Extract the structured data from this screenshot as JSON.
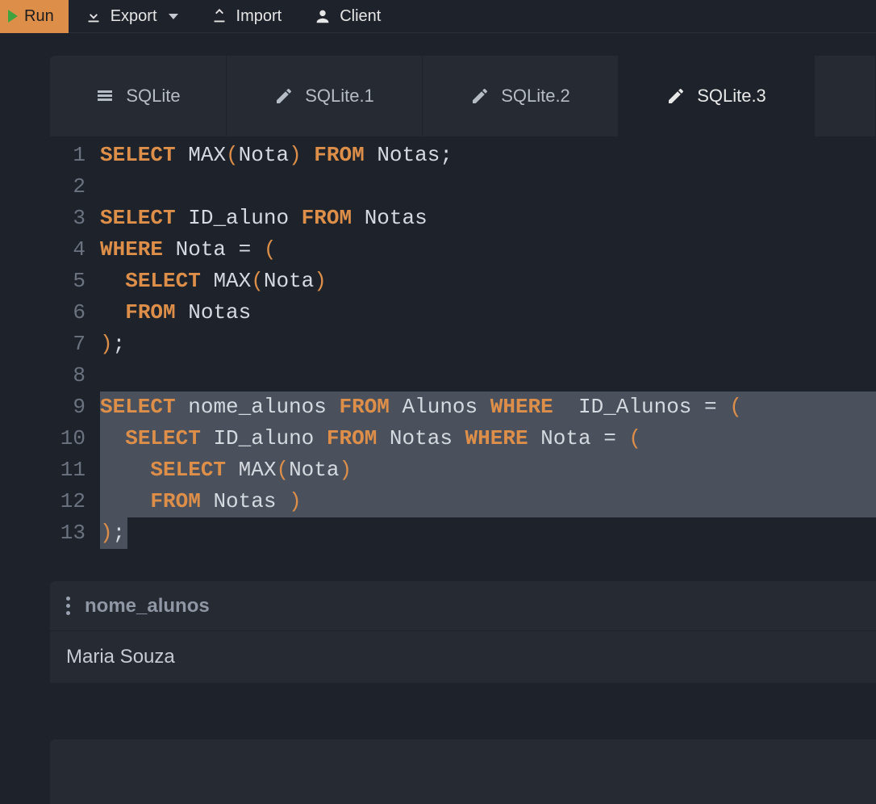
{
  "toolbar": {
    "run": "Run",
    "export": "Export",
    "import": "Import",
    "client": "Client"
  },
  "tabs": [
    {
      "label": "SQLite",
      "icon": "database-icon",
      "active": false
    },
    {
      "label": "SQLite.1",
      "icon": "edit-icon",
      "active": false
    },
    {
      "label": "SQLite.2",
      "icon": "edit-icon",
      "active": false
    },
    {
      "label": "SQLite.3",
      "icon": "edit-icon",
      "active": true
    }
  ],
  "code_lines": [
    {
      "n": 1,
      "tokens": [
        [
          "kw",
          "SELECT"
        ],
        [
          "sp",
          " "
        ],
        [
          "fn",
          "MAX"
        ],
        [
          "pn",
          "("
        ],
        [
          "id",
          "Nota"
        ],
        [
          "pn",
          ")"
        ],
        [
          "sp",
          " "
        ],
        [
          "kw",
          "FROM"
        ],
        [
          "sp",
          " "
        ],
        [
          "id",
          "Notas"
        ],
        [
          "op",
          ";"
        ]
      ]
    },
    {
      "n": 2,
      "tokens": []
    },
    {
      "n": 3,
      "tokens": [
        [
          "kw",
          "SELECT"
        ],
        [
          "sp",
          " "
        ],
        [
          "id",
          "ID_aluno"
        ],
        [
          "sp",
          " "
        ],
        [
          "kw",
          "FROM"
        ],
        [
          "sp",
          " "
        ],
        [
          "id",
          "Notas"
        ]
      ]
    },
    {
      "n": 4,
      "tokens": [
        [
          "kw",
          "WHERE"
        ],
        [
          "sp",
          " "
        ],
        [
          "id",
          "Nota"
        ],
        [
          "sp",
          " "
        ],
        [
          "op",
          "="
        ],
        [
          "sp",
          " "
        ],
        [
          "pn",
          "("
        ]
      ]
    },
    {
      "n": 5,
      "tokens": [
        [
          "sp",
          "  "
        ],
        [
          "kw",
          "SELECT"
        ],
        [
          "sp",
          " "
        ],
        [
          "fn",
          "MAX"
        ],
        [
          "pn",
          "("
        ],
        [
          "id",
          "Nota"
        ],
        [
          "pn",
          ")"
        ]
      ]
    },
    {
      "n": 6,
      "tokens": [
        [
          "sp",
          "  "
        ],
        [
          "kw",
          "FROM"
        ],
        [
          "sp",
          " "
        ],
        [
          "id",
          "Notas"
        ]
      ]
    },
    {
      "n": 7,
      "tokens": [
        [
          "pn",
          ")"
        ],
        [
          "op",
          ";"
        ]
      ]
    },
    {
      "n": 8,
      "tokens": []
    },
    {
      "n": 9,
      "sel": "full",
      "tokens": [
        [
          "kw",
          "SELECT"
        ],
        [
          "sp",
          " "
        ],
        [
          "id",
          "nome_alunos"
        ],
        [
          "sp",
          " "
        ],
        [
          "kw",
          "FROM"
        ],
        [
          "sp",
          " "
        ],
        [
          "id",
          "Alunos"
        ],
        [
          "sp",
          " "
        ],
        [
          "kw",
          "WHERE"
        ],
        [
          "sp",
          "  "
        ],
        [
          "id",
          "ID_Alunos"
        ],
        [
          "sp",
          " "
        ],
        [
          "op",
          "="
        ],
        [
          "sp",
          " "
        ],
        [
          "pn",
          "("
        ]
      ]
    },
    {
      "n": 10,
      "sel": "full",
      "tokens": [
        [
          "sp",
          "  "
        ],
        [
          "kw",
          "SELECT"
        ],
        [
          "sp",
          " "
        ],
        [
          "id",
          "ID_aluno"
        ],
        [
          "sp",
          " "
        ],
        [
          "kw",
          "FROM"
        ],
        [
          "sp",
          " "
        ],
        [
          "id",
          "Notas"
        ],
        [
          "sp",
          " "
        ],
        [
          "kw",
          "WHERE"
        ],
        [
          "sp",
          " "
        ],
        [
          "id",
          "Nota"
        ],
        [
          "sp",
          " "
        ],
        [
          "op",
          "="
        ],
        [
          "sp",
          " "
        ],
        [
          "pn",
          "("
        ]
      ]
    },
    {
      "n": 11,
      "sel": "full",
      "tokens": [
        [
          "sp",
          "    "
        ],
        [
          "kw",
          "SELECT"
        ],
        [
          "sp",
          " "
        ],
        [
          "fn",
          "MAX"
        ],
        [
          "pn",
          "("
        ],
        [
          "id",
          "Nota"
        ],
        [
          "pn",
          ")"
        ]
      ]
    },
    {
      "n": 12,
      "sel": "full",
      "tokens": [
        [
          "sp",
          "    "
        ],
        [
          "kw",
          "FROM"
        ],
        [
          "sp",
          " "
        ],
        [
          "id",
          "Notas"
        ],
        [
          "sp",
          " "
        ],
        [
          "pn",
          ")"
        ]
      ]
    },
    {
      "n": 13,
      "sel": "partial",
      "tokens": [
        [
          "pn",
          ")"
        ],
        [
          "op",
          ";"
        ]
      ]
    }
  ],
  "result": {
    "columns": [
      "nome_alunos"
    ],
    "rows": [
      [
        "Maria Souza"
      ]
    ]
  }
}
